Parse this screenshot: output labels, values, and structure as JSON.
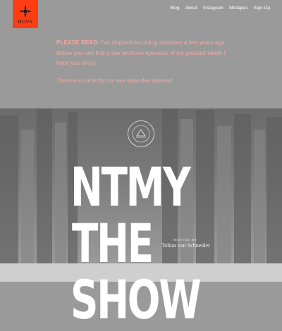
{
  "logo": {
    "text": "HOVS"
  },
  "nav": [
    {
      "label": "Blog"
    },
    {
      "label": "About"
    },
    {
      "label": "Instagram"
    },
    {
      "label": "Mixtapes"
    },
    {
      "label": "Sign Up"
    }
  ],
  "notice": {
    "lead": "PLEASE READ:",
    "body": "I've stopped recording episodes a few years ago. Below you can find a few archived episodes of my podcast which I hope you enjoy.",
    "second": "There are currently no new episodes planned."
  },
  "hero": {
    "title_lines": [
      "NTMY",
      "THE",
      "SHOW"
    ],
    "hosted_by": "HOSTED BY",
    "host_name": "Tobias van Schneider"
  },
  "colors": {
    "accent": "#ff3d12",
    "notice_text": "#f2a9a4"
  }
}
